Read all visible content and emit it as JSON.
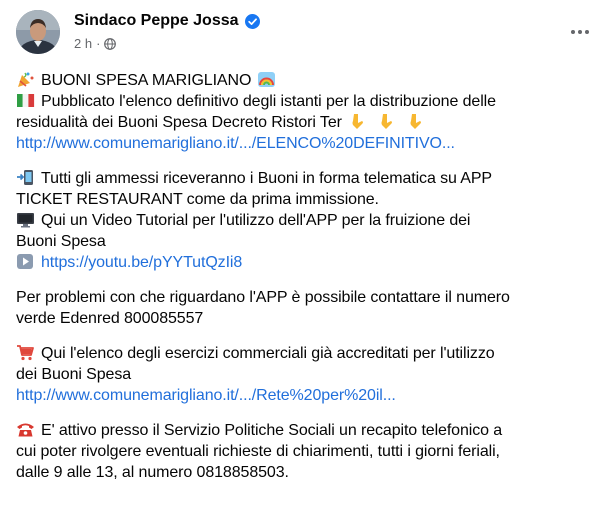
{
  "post": {
    "author": "Sindaco Peppe Jossa",
    "time": "2 h",
    "separator": "·",
    "icons": {
      "verified": "verified-badge-icon",
      "audience": "globe-icon",
      "menu": "more-options-icon"
    }
  },
  "body": {
    "p1": {
      "l1": "BUONI SPESA MARIGLIANO",
      "l2": "Pubblicato l'elenco definitivo degli istanti per la distribuzione delle",
      "l3": "residualità dei Buoni Spesa Decreto Ristori Ter",
      "l4": "http://www.comunemarigliano.it/.../ELENCO%20DEFINITIVO..."
    },
    "p2": {
      "l1": "Tutti gli ammessi riceveranno i Buoni in forma telematica su APP",
      "l2": "TICKET RESTAURANT come da prima immissione.",
      "l3": "Qui un Video Tutorial per l'utilizzo dell'APP  per la fruizione dei",
      "l4": "Buoni Spesa",
      "l5": "https://youtu.be/pYYTutQzIi8"
    },
    "p3": {
      "l1": "Per problemi con che riguardano l'APP è possibile contattare il numero",
      "l2": "verde Edenred 800085557"
    },
    "p4": {
      "l1": "Qui l'elenco degli esercizi commerciali già accreditati per l'utilizzo",
      "l2": "dei Buoni Spesa",
      "l3": "http://www.comunemarigliano.it/.../Rete%20per%20il..."
    },
    "p5": {
      "l1": "E' attivo presso il Servizio Politiche Sociali un recapito telefonico a",
      "l2": "cui poter rivolgere eventuali richieste di chiarimenti, tutti i giorni feriali,",
      "l3": "dalle 9 alle 13, al numero 0818858503."
    }
  },
  "colors": {
    "link": "#216fdb",
    "meta": "#65676b",
    "verified": "#1877f2"
  }
}
